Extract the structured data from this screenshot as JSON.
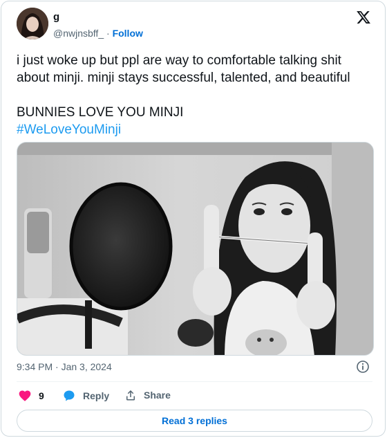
{
  "author": {
    "display_name": "g",
    "handle": "@nwjnsbff_",
    "separator": "·",
    "follow_label": "Follow"
  },
  "tweet": {
    "line1": "i just woke up but ppl are way to comfortable talking shit",
    "line2": "about minji. minji stays successful, talented, and beautiful",
    "line3": "BUNNIES LOVE YOU MINJI",
    "hashtag": "#WeLoveYouMinji"
  },
  "timestamp": "9:34 PM · Jan 3, 2024",
  "actions": {
    "like_count": "9",
    "reply_label": "Reply",
    "share_label": "Share"
  },
  "read_replies_label": "Read 3 replies",
  "icons": {
    "logo": "x-logo-icon",
    "info": "info-icon",
    "like": "heart-icon",
    "reply": "speech-bubble-icon",
    "share": "share-icon"
  },
  "colors": {
    "accent": "#1d9bf0",
    "link": "#006fd6",
    "like": "#f91880",
    "secondary_text": "#536471",
    "border": "#cfd9de"
  }
}
